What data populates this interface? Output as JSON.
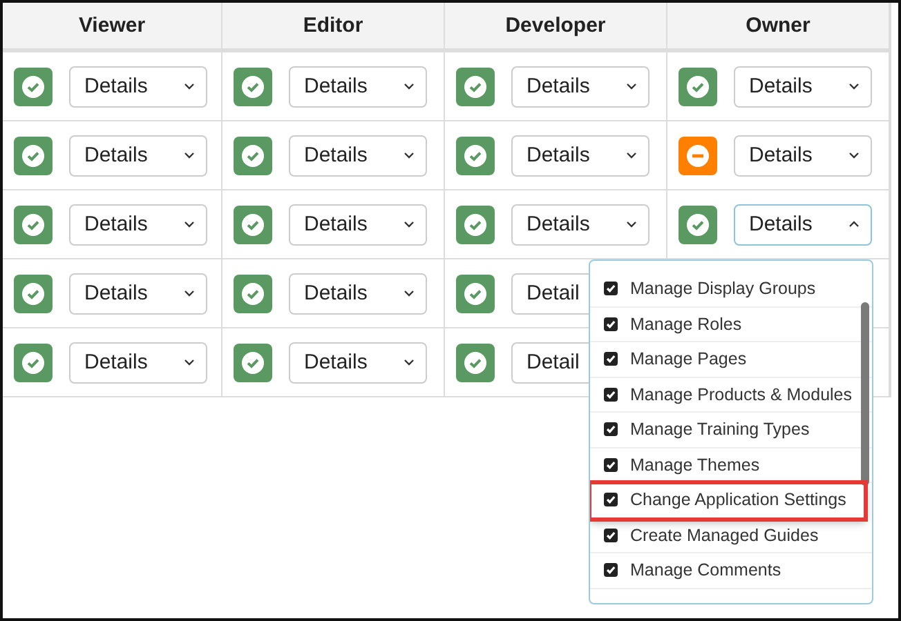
{
  "columns": [
    "Viewer",
    "Editor",
    "Developer",
    "Owner"
  ],
  "rows": [
    {
      "cells": [
        {
          "granted": true,
          "label": "Details",
          "expanded": false
        },
        {
          "granted": true,
          "label": "Details",
          "expanded": false
        },
        {
          "granted": true,
          "label": "Details",
          "expanded": false
        },
        {
          "granted": true,
          "label": "Details",
          "expanded": false
        }
      ]
    },
    {
      "cells": [
        {
          "granted": true,
          "label": "Details",
          "expanded": false
        },
        {
          "granted": true,
          "label": "Details",
          "expanded": false
        },
        {
          "granted": true,
          "label": "Details",
          "expanded": false
        },
        {
          "granted": false,
          "label": "Details",
          "expanded": false
        }
      ]
    },
    {
      "cells": [
        {
          "granted": true,
          "label": "Details",
          "expanded": false
        },
        {
          "granted": true,
          "label": "Details",
          "expanded": false
        },
        {
          "granted": true,
          "label": "Details",
          "expanded": false
        },
        {
          "granted": true,
          "label": "Details",
          "expanded": true
        }
      ]
    },
    {
      "cells": [
        {
          "granted": true,
          "label": "Details",
          "expanded": false
        },
        {
          "granted": true,
          "label": "Details",
          "expanded": false
        },
        {
          "granted": true,
          "label": "Detail",
          "expanded": false
        }
      ]
    },
    {
      "cells": [
        {
          "granted": true,
          "label": "Details",
          "expanded": false
        },
        {
          "granted": true,
          "label": "Details",
          "expanded": false
        },
        {
          "granted": true,
          "label": "Detail",
          "expanded": false
        }
      ]
    }
  ],
  "popup": {
    "items": [
      {
        "label": "Manage Display Groups",
        "checked": true,
        "highlighted": false
      },
      {
        "label": "Manage Roles",
        "checked": true,
        "highlighted": false
      },
      {
        "label": "Manage Pages",
        "checked": true,
        "highlighted": false
      },
      {
        "label": "Manage Products & Modules",
        "checked": true,
        "highlighted": false
      },
      {
        "label": "Manage Training Types",
        "checked": true,
        "highlighted": false
      },
      {
        "label": "Manage Themes",
        "checked": true,
        "highlighted": false
      },
      {
        "label": "Change Application Settings",
        "checked": true,
        "highlighted": true
      },
      {
        "label": "Create Managed Guides",
        "checked": true,
        "highlighted": false
      },
      {
        "label": "Manage Comments",
        "checked": true,
        "highlighted": false
      }
    ]
  }
}
